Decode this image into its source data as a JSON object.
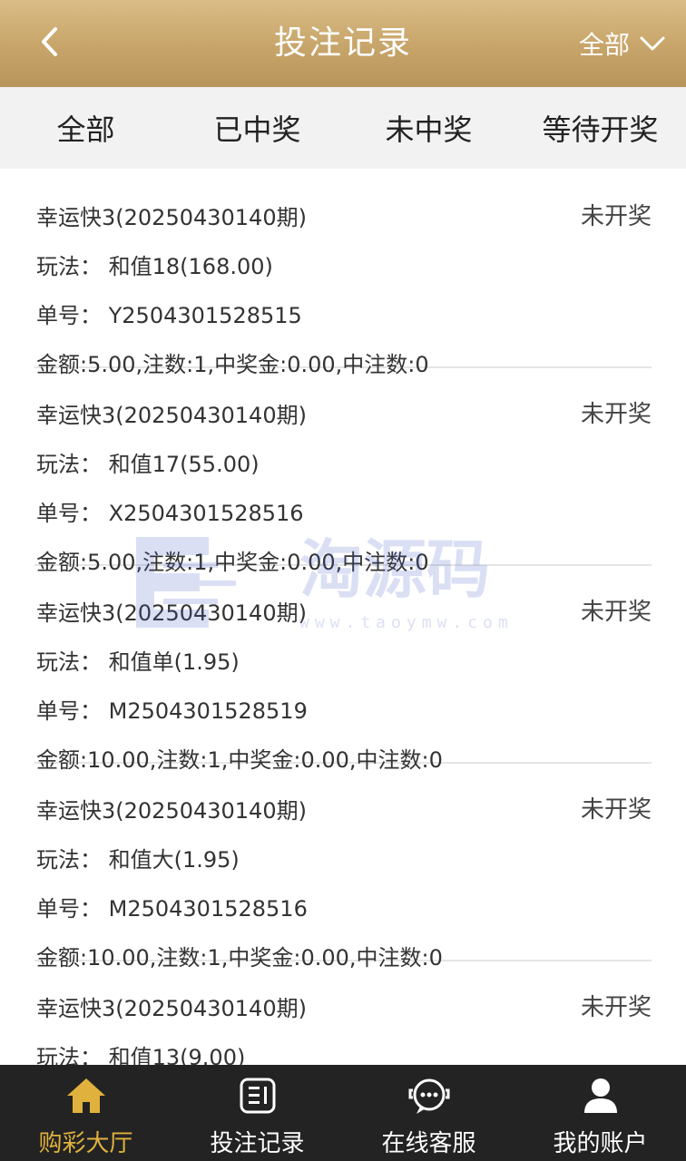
{
  "header": {
    "title": "投注记录",
    "filter_label": "全部"
  },
  "tabs": [
    {
      "label": "全部"
    },
    {
      "label": "已中奖"
    },
    {
      "label": "未中奖"
    },
    {
      "label": "等待开奖"
    }
  ],
  "records": [
    {
      "game": "幸运快3(20250430140期)",
      "status": "未开奖",
      "play": "玩法：  和值18(168.00)",
      "order": "单号：  Y2504301528515",
      "summary": "金额:5.00,注数:1,中奖金:0.00,中注数:0"
    },
    {
      "game": "幸运快3(20250430140期)",
      "status": "未开奖",
      "play": "玩法：  和值17(55.00)",
      "order": "单号：  X2504301528516",
      "summary": "金额:5.00,注数:1,中奖金:0.00,中注数:0"
    },
    {
      "game": "幸运快3(20250430140期)",
      "status": "未开奖",
      "play": "玩法：  和值单(1.95)",
      "order": "单号：  M2504301528519",
      "summary": "金额:10.00,注数:1,中奖金:0.00,中注数:0"
    },
    {
      "game": "幸运快3(20250430140期)",
      "status": "未开奖",
      "play": "玩法：  和值大(1.95)",
      "order": "单号：  M2504301528516",
      "summary": "金额:10.00,注数:1,中奖金:0.00,中注数:0"
    },
    {
      "game": "幸运快3(20250430140期)",
      "status": "未开奖",
      "play": "玩法：  和值13(9.00)",
      "order": "",
      "summary": ""
    }
  ],
  "watermark": {
    "text": "淘源码",
    "url": "www.taoymw.com"
  },
  "nav": [
    {
      "label": "购彩大厅",
      "icon": "home-icon",
      "active": true
    },
    {
      "label": "投注记录",
      "icon": "record-icon",
      "active": false
    },
    {
      "label": "在线客服",
      "icon": "chat-icon",
      "active": false
    },
    {
      "label": "我的账户",
      "icon": "user-icon",
      "active": false
    }
  ],
  "colors": {
    "header_gold": "#c7a469",
    "active_gold": "#e0b23d",
    "nav_bg": "#232323",
    "tab_bg": "#f2f2f2"
  }
}
